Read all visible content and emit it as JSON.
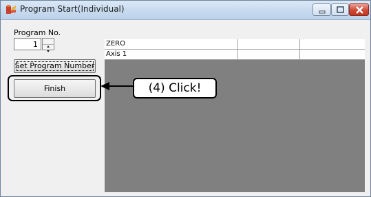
{
  "window": {
    "title": "Program Start(Individual)"
  },
  "form": {
    "program_label": "Program No.",
    "program_value": "1",
    "set_button_label": "Set Program Number",
    "finish_button_label": "Finish"
  },
  "grid": {
    "rows": [
      {
        "col1": "ZERO"
      },
      {
        "col1": "Axis 1"
      }
    ]
  },
  "annotation": {
    "callout_text": "(4) Click!"
  },
  "colors": {
    "grid_background": "#808080",
    "close_button": "#c1351e",
    "titlebar": "#c6d9ee"
  }
}
